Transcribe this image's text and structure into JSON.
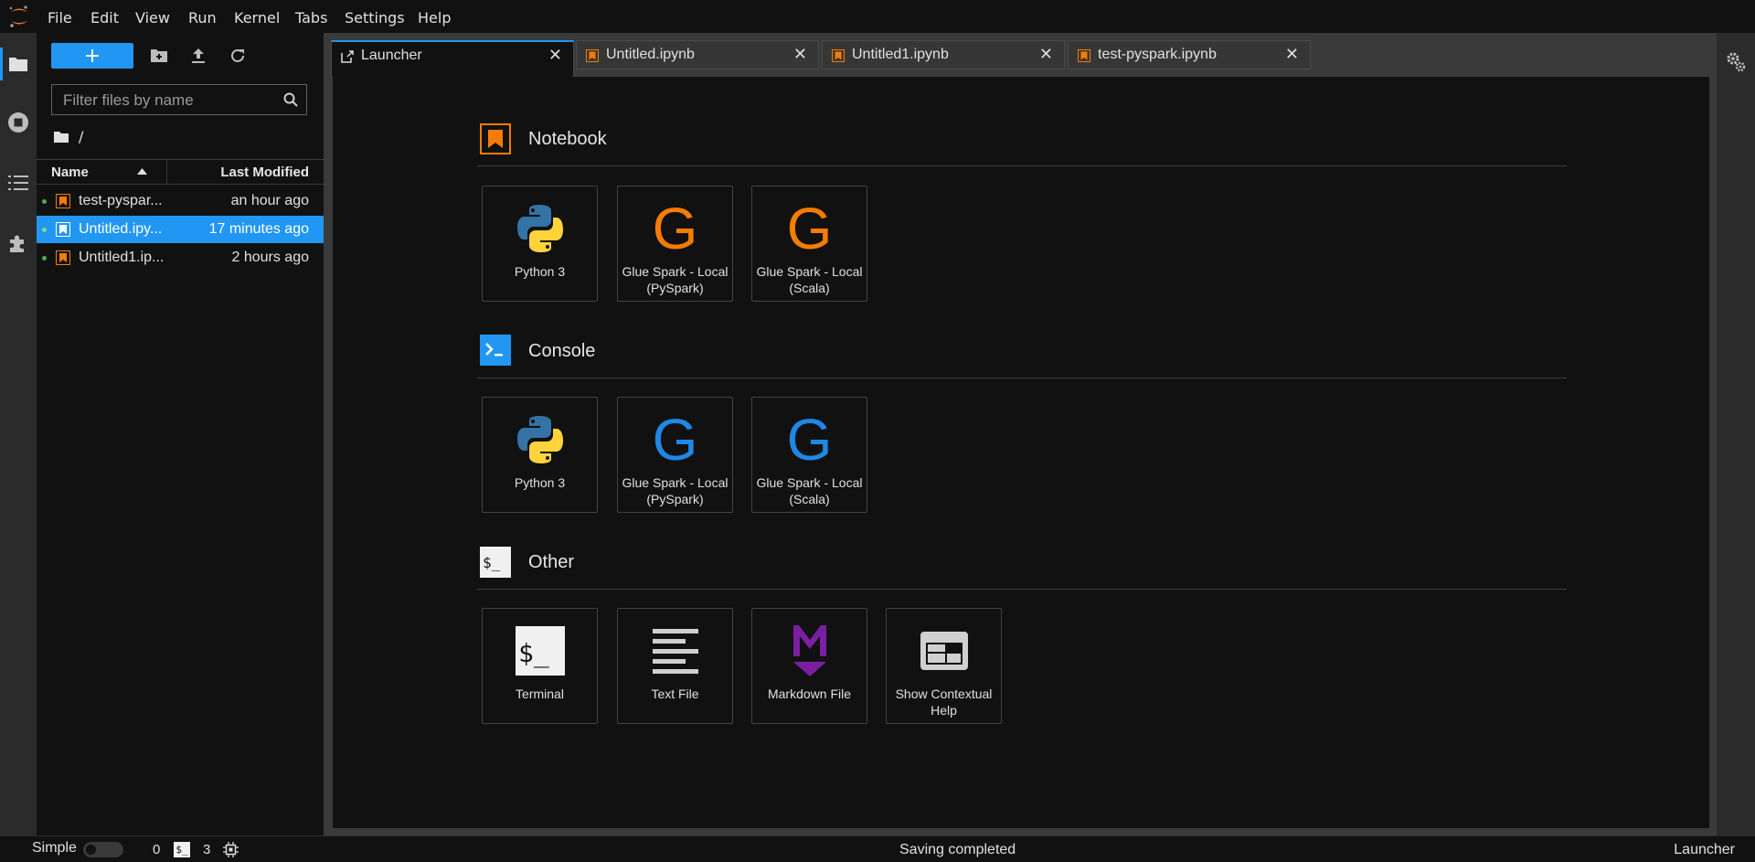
{
  "menubar": {
    "items": [
      "File",
      "Edit",
      "View",
      "Run",
      "Kernel",
      "Tabs",
      "Settings",
      "Help"
    ]
  },
  "filebrowser": {
    "new_label": "+",
    "filter_placeholder": "Filter files by name",
    "breadcrumb": "/",
    "columns": {
      "name": "Name",
      "modified": "Last Modified"
    },
    "files": [
      {
        "name": "test-pyspar...",
        "modified": "an hour ago",
        "selected": false
      },
      {
        "name": "Untitled.ipy...",
        "modified": "17 minutes ago",
        "selected": true
      },
      {
        "name": "Untitled1.ip...",
        "modified": "2 hours ago",
        "selected": false
      }
    ]
  },
  "tabs": [
    {
      "label": "Launcher",
      "active": true,
      "icon": "launcher-icon"
    },
    {
      "label": "Untitled.ipynb",
      "active": false,
      "icon": "notebook-icon"
    },
    {
      "label": "Untitled1.ipynb",
      "active": false,
      "icon": "notebook-icon"
    },
    {
      "label": "test-pyspark.ipynb",
      "active": false,
      "icon": "notebook-icon"
    }
  ],
  "launcher": {
    "sections": [
      {
        "title": "Notebook",
        "cards": [
          {
            "label": "Python 3",
            "icon": "python-icon"
          },
          {
            "label": "Glue Spark - Local (PySpark)",
            "icon": "glue-g-orange-icon"
          },
          {
            "label": "Glue Spark - Local (Scala)",
            "icon": "glue-g-orange-icon"
          }
        ]
      },
      {
        "title": "Console",
        "cards": [
          {
            "label": "Python 3",
            "icon": "python-icon"
          },
          {
            "label": "Glue Spark - Local (PySpark)",
            "icon": "glue-g-blue-icon"
          },
          {
            "label": "Glue Spark - Local (Scala)",
            "icon": "glue-g-blue-icon"
          }
        ]
      },
      {
        "title": "Other",
        "cards": [
          {
            "label": "Terminal",
            "icon": "terminal-icon"
          },
          {
            "label": "Text File",
            "icon": "text-file-icon"
          },
          {
            "label": "Markdown File",
            "icon": "markdown-icon"
          },
          {
            "label": "Show Contextual Help",
            "icon": "contextual-help-icon"
          }
        ]
      }
    ],
    "glue_letter": "G"
  },
  "statusbar": {
    "mode_label": "Simple",
    "kernels_count": "0",
    "terminals_count": "3",
    "terminal_badge": "$_",
    "message": "Saving completed",
    "current": "Launcher"
  },
  "colors": {
    "accent": "#2196f3",
    "notebook_orange": "#f57c00",
    "glue_blue": "#1e88e5",
    "markdown_purple": "#7b1fa2"
  }
}
